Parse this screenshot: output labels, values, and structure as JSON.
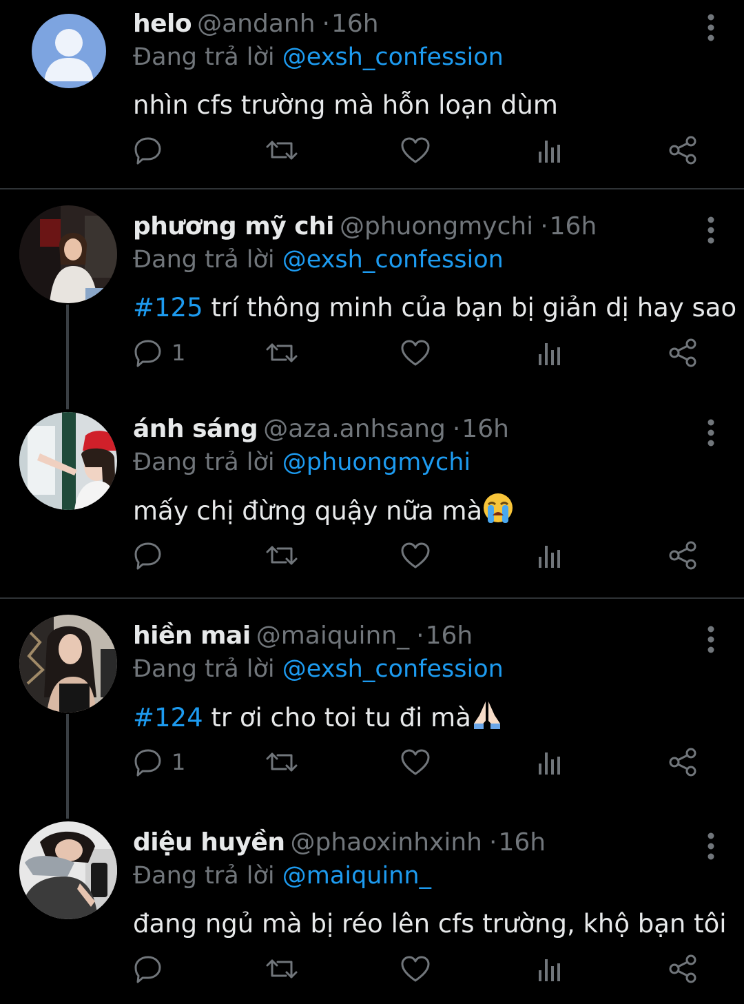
{
  "reply_prefix": "Đang trả lời",
  "tweets": [
    {
      "name": "helo",
      "handle": "@andanh",
      "time": "16h",
      "reply_to": "@exsh_confession",
      "hashtag": "",
      "text": "nhìn cfs trường mà hỗn loạn dùm",
      "emoji": "",
      "reply_count": ""
    },
    {
      "name": "phương mỹ chi",
      "handle": "@phuongmychi",
      "time": "16h",
      "reply_to": "@exsh_confession",
      "hashtag": "#125",
      "text": " trí thông minh của bạn bị giản dị hay sao",
      "emoji": "",
      "reply_count": "1"
    },
    {
      "name": "ánh sáng",
      "handle": "@aza.anhsang",
      "time": "16h",
      "reply_to": "@phuongmychi",
      "hashtag": "",
      "text": "mấy chị đừng quậy nữa mà",
      "emoji": "loudly-crying-face-emoji",
      "reply_count": ""
    },
    {
      "name": "hiền mai",
      "handle": "@maiquinn_",
      "time": "16h",
      "reply_to": "@exsh_confession",
      "hashtag": "#124",
      "text": " tr ơi cho toi tu đi mà",
      "emoji": "folded-hands-emoji",
      "reply_count": "1"
    },
    {
      "name": "diệu huyền",
      "handle": "@phaoxinhxinh",
      "time": "16h",
      "reply_to": "@maiquinn_",
      "hashtag": "",
      "text": "đang ngủ mà bị réo lên cfs trường, khộ bạn tôi",
      "emoji": "",
      "reply_count": ""
    }
  ],
  "colors": {
    "background": "#000000",
    "text": "#e7e9ea",
    "muted": "#71767b",
    "link": "#1d9bf0",
    "divider": "#2f3336"
  },
  "icons": [
    "more-vertical-icon",
    "reply-icon",
    "retweet-icon",
    "like-icon",
    "views-icon",
    "share-icon"
  ]
}
